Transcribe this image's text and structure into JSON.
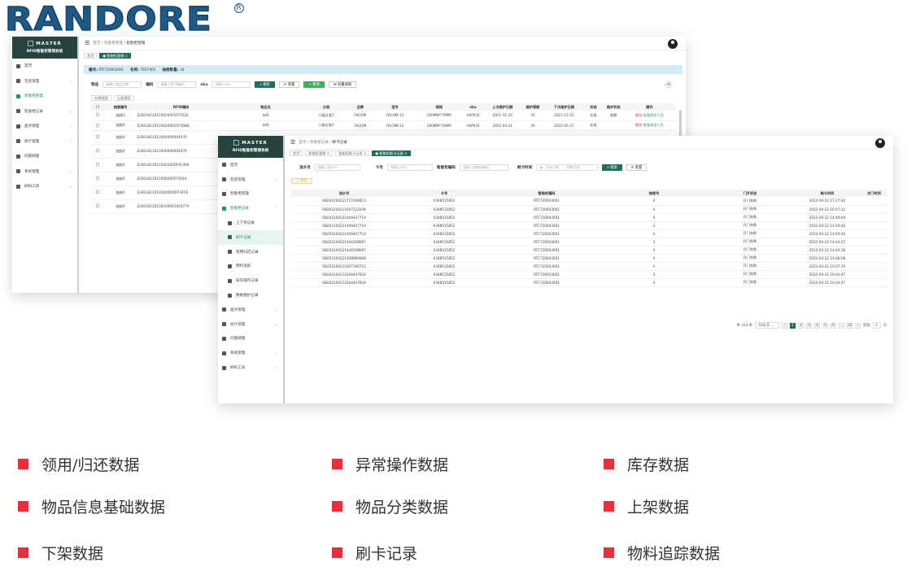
{
  "logo": {
    "text": "RANDORE",
    "reg": "R",
    "colors": {
      "brand": "#1f5a86"
    }
  },
  "app": {
    "brand": "MASTER",
    "brand_sub": "RFID智能柜管理系统",
    "colors": {
      "sidebar": "#27433f",
      "accent": "#1f6f5c",
      "active": "#1a8f7a"
    }
  },
  "back": {
    "breadcrumb": [
      "首页",
      "智能柜管理",
      "智能柜管理"
    ],
    "tabs": [
      "首页",
      "智能柜管理"
    ],
    "info": {
      "code_label": "编号:",
      "code": "RTC720003001",
      "name_label": "名称:",
      "name": "TEST-001",
      "count_label": "抽屉数量:",
      "count": "34"
    },
    "form": {
      "item_label": "物品",
      "item_ph": "请输入物品名称",
      "rfid_label": "编码",
      "rfid_ph": "请输入RFID编码",
      "sku_label": "sku",
      "sku_ph": "请输入sku",
      "search": "搜索",
      "reset": "重置",
      "add": "新增",
      "export": "批量调拨"
    },
    "subtabs": [
      "存储视图",
      "分类视图"
    ],
    "columns": [
      "",
      "抽屉编号",
      "RFID编码",
      "物品名",
      "分类",
      "品牌",
      "型号",
      "规格",
      "sku",
      "上次维护日期",
      "维护周期",
      "下次维护日期",
      "状态",
      "维护状态",
      "操作"
    ],
    "rows": [
      [
        "",
        "抽屉3",
        "E20034120120020002FF1032",
        "冰杯",
        "二级分类1",
        "FACOM",
        "FACOM-12",
        "200MM*70MM",
        "AAP032",
        "2021-11-25",
        "30",
        "2021-12-25",
        "在架",
        "超期",
        "删除",
        "查看绑定人员"
      ],
      [
        "",
        "抽屉4",
        "E2003412012002000ZFF6DB6",
        "冰杯",
        "二级分类1",
        "FACOM",
        "FACOM-12",
        "200MM*70MM",
        "AAP032",
        "2022-04-21",
        "30",
        "2022-05-21",
        "在架",
        "",
        "删除",
        "查看绑定人员"
      ],
      [
        "",
        "抽屉4",
        "E2003412013400000004476",
        "",
        "",
        "",
        "",
        "",
        "",
        "",
        "",
        "",
        "",
        "",
        "",
        ""
      ],
      [
        "",
        "抽屉4",
        "E2003412013400000004470",
        "",
        "",
        "",
        "",
        "",
        "",
        "",
        "",
        "",
        "",
        "",
        "",
        ""
      ],
      [
        "",
        "抽屉4",
        "E2003412012500200DFEF466",
        "",
        "",
        "",
        "",
        "",
        "",
        "",
        "",
        "",
        "",
        "",
        "",
        ""
      ],
      [
        "",
        "抽屉4",
        "E2003412012000000FF5654",
        "",
        "",
        "",
        "",
        "",
        "",
        "",
        "",
        "",
        "",
        "",
        "",
        ""
      ],
      [
        "",
        "抽屉4",
        "E20034120120000000FF4FF6",
        "",
        "",
        "",
        "",
        "",
        "",
        "",
        "",
        "",
        "",
        "",
        "",
        ""
      ],
      [
        "",
        "抽屉4",
        "E2003412013610000192077A",
        "",
        "",
        "",
        "",
        "",
        "",
        "",
        "",
        "",
        "",
        "",
        "",
        ""
      ]
    ],
    "nav": [
      {
        "label": "首页",
        "arrow": ""
      },
      {
        "label": "包装管理",
        "arrow": "⌄"
      },
      {
        "label": "智能柜管理",
        "arrow": "",
        "active": true
      },
      {
        "label": "智能柜记录",
        "arrow": "⌄"
      },
      {
        "label": "盘点管理",
        "arrow": "⌄"
      },
      {
        "label": "统计管理",
        "arrow": "⌄"
      },
      {
        "label": "问题助理",
        "arrow": ""
      },
      {
        "label": "系统管理",
        "arrow": "⌄"
      },
      {
        "label": "刷码工具",
        "arrow": "⌄"
      }
    ]
  },
  "front": {
    "breadcrumb": [
      "首页",
      "智能柜记录",
      "刷卡记录"
    ],
    "tabs": [
      "首页",
      "智能柜管理",
      "智能柜刷卡记录",
      "智能柜刷卡记录"
    ],
    "form": {
      "serial_label": "流水号",
      "serial_ph": "请输入流水号",
      "card_label": "卡号",
      "card_ph": "请输入卡号",
      "cab_label": "智能柜编码",
      "cab_ph": "请输入智能柜编码",
      "time_label": "刷卡时间",
      "start_ph": "开始日期",
      "sep": "-",
      "end_ph": "结束日期",
      "search": "搜索",
      "reset": "重置",
      "export": "导出"
    },
    "columns": [
      "流水号",
      "卡号",
      "智能柜编码",
      "抽屉号",
      "门开状态",
      "刷卡时间",
      "关门时间"
    ],
    "rows": [
      [
        "SN202204221727448813",
        "0348515852",
        "RTC720003001",
        "4",
        "开门失败",
        "2022-04-22 17:27:44",
        ""
      ],
      [
        "SN202204221647122036",
        "0348515852",
        "RTC720003001",
        "4",
        "开门失败",
        "2022-04-22 16:47:12",
        ""
      ],
      [
        "SN202204221449447714",
        "0348515852",
        "RTC720003001",
        "4",
        "开门失败",
        "2022-04-22 14:49:44",
        ""
      ],
      [
        "SN202204221449447714",
        "0348515852",
        "RTC720003001",
        "3",
        "开门失败",
        "2022-04-22 14:49:44",
        ""
      ],
      [
        "SN202204221449447714",
        "0348515852",
        "RTC720003001",
        "4",
        "开门失败",
        "2022-04-22 14:49:44",
        ""
      ],
      [
        "SN202204221444208667",
        "0348515852",
        "RTC720003001",
        "3",
        "开门失败",
        "2022-04-22 14:44:27",
        ""
      ],
      [
        "SN202204221444208667",
        "0348515852",
        "RTC720003001",
        "4",
        "开门失败",
        "2022-04-22 14:44:28",
        ""
      ],
      [
        "SN202204221408089468",
        "0348515852",
        "RTC720003001",
        "4",
        "开门失败",
        "2022-04-22 14:08:08",
        ""
      ],
      [
        "SN202204221007190712",
        "0348515852",
        "RTC720003001",
        "4",
        "开门失败",
        "2022-04-22 10:07:19",
        ""
      ],
      [
        "SN202204211644447834",
        "0348515852",
        "RTC720003001",
        "3",
        "开门失败",
        "2022-04-21 16:44:47",
        ""
      ],
      [
        "SN202204211644447834",
        "0348515852",
        "RTC720003001",
        "4",
        "开门失败",
        "2022-04-21 16:44:47",
        ""
      ]
    ],
    "pager": {
      "total": "共 314 条",
      "size": "10条/页",
      "pages": [
        "‹",
        "1",
        "2",
        "3",
        "4",
        "5",
        "6",
        "…",
        "32",
        "›"
      ],
      "goto": "前往",
      "page": "1",
      "unit": "页"
    },
    "nav": [
      {
        "label": "首页",
        "arrow": ""
      },
      {
        "label": "包装管理",
        "arrow": "⌄"
      },
      {
        "label": "智能柜管理",
        "arrow": ""
      },
      {
        "label": "智能柜记录",
        "arrow": "⌃",
        "active": true
      },
      {
        "label": "上下架记录",
        "arrow": "",
        "sub": true
      },
      {
        "label": "刷卡记录",
        "arrow": "",
        "sub": true,
        "sel": true
      },
      {
        "label": "借用归还记录",
        "arrow": "",
        "sub": true
      },
      {
        "label": "物料追踪",
        "arrow": "",
        "sub": true
      },
      {
        "label": "异常操作记录",
        "arrow": "",
        "sub": true
      },
      {
        "label": "数据维护记录",
        "arrow": "",
        "sub": true
      },
      {
        "label": "盘点管理",
        "arrow": "⌄"
      },
      {
        "label": "统计管理",
        "arrow": "⌄"
      },
      {
        "label": "问题助理",
        "arrow": ""
      },
      {
        "label": "系统管理",
        "arrow": "⌄"
      },
      {
        "label": "刷码工具",
        "arrow": "⌄"
      }
    ]
  },
  "features": [
    {
      "label": "领用/归还数据"
    },
    {
      "label": "异常操作数据"
    },
    {
      "label": "库存数据"
    },
    {
      "label": "物品信息基础数据"
    },
    {
      "label": "物品分类数据"
    },
    {
      "label": "上架数据"
    },
    {
      "label": "下架数据"
    },
    {
      "label": "刷卡记录"
    },
    {
      "label": "物料追踪数据"
    }
  ]
}
